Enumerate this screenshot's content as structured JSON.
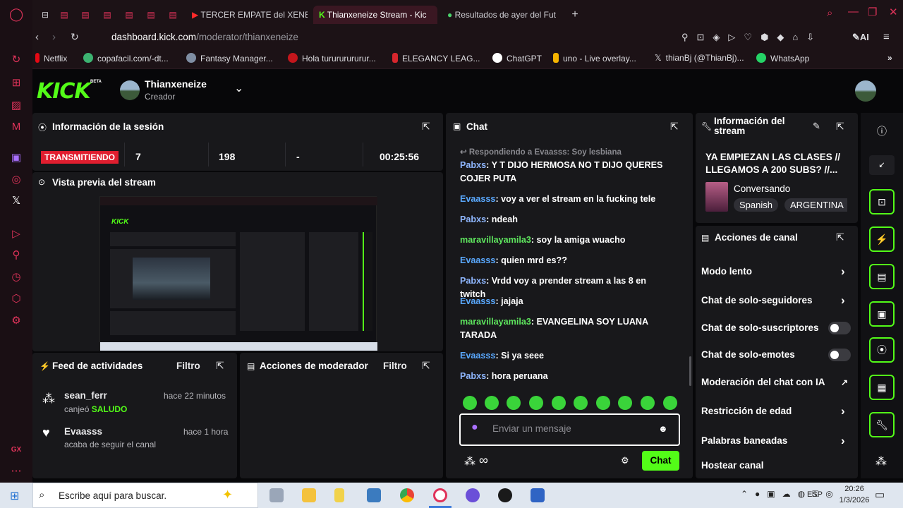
{
  "browser": {
    "tabs": [
      {
        "label": "TERCER EMPATE del XENE",
        "active": false
      },
      {
        "label": "Thianxeneize Stream - Kic",
        "active": true
      },
      {
        "label": "Resultados de ayer del Fut",
        "active": false
      }
    ],
    "new_tab": "+",
    "url_host": "dashboard.kick.com",
    "url_path": "/moderator/thianxeneize",
    "ai_label": "AI",
    "bookmarks": [
      "Netflix",
      "copafacil.com/-dt...",
      "Fantasy Manager...",
      "Hola turururururur...",
      "ELEGANCY LEAG...",
      "ChatGPT",
      "uno - Live overlay...",
      "thianBj (@ThianBj)...",
      "WhatsApp"
    ],
    "gx_label": "GX"
  },
  "header": {
    "logo": "KICK",
    "logo_badge": "BETA",
    "channel_name": "Thianxeneize",
    "channel_role": "Creador"
  },
  "session": {
    "title": "Información de la sesión",
    "status_badge": "TRANSMITIENDO",
    "stats": [
      "7",
      "198",
      "-",
      "00:25:56"
    ]
  },
  "preview": {
    "title": "Vista previa del stream"
  },
  "activity": {
    "title": "Feed de actividades",
    "filter": "Filtro",
    "items": [
      {
        "user": "sean_ferr",
        "time": "hace 22 minutos",
        "text": "canjeó",
        "highlight": "SALUDO"
      },
      {
        "user": "Evaasss",
        "time": "hace 1 hora",
        "text": "acaba de seguir el canal",
        "highlight": ""
      }
    ]
  },
  "mod_actions": {
    "title": "Acciones de moderador",
    "filter": "Filtro"
  },
  "chat": {
    "title": "Chat",
    "reply_context": "Respondiendo a Evaasss: Soy lesbiana",
    "messages": [
      {
        "user": "Pabxs",
        "text": "Y T DIJO HERMOSA NO T DIJO QUERES COJER PUTA",
        "color": "#8fb7ff"
      },
      {
        "user": "Evaasss",
        "text": "voy a ver el stream en la fucking tele",
        "color": "#5aa9ff"
      },
      {
        "user": "Pabxs",
        "text": "ndeah",
        "color": "#8fb7ff"
      },
      {
        "user": "maravillayamila3",
        "text": "soy la amiga wuacho",
        "color": "#5ee65e"
      },
      {
        "user": "Evaasss",
        "text": "quien mrd es??",
        "color": "#5aa9ff"
      },
      {
        "user": "Pabxs",
        "text": "Vrdd voy a prender stream a las 8 en twitch",
        "color": "#8fb7ff"
      },
      {
        "user": "Evaasss",
        "text": "jajaja",
        "color": "#5aa9ff"
      },
      {
        "user": "maravillayamila3",
        "text": "EVANGELINA SOY LUANA TARADA",
        "color": "#5ee65e"
      },
      {
        "user": "Evaasss",
        "text": "Si ya seee",
        "color": "#5aa9ff"
      },
      {
        "user": "Pabxs",
        "text": "hora peruana",
        "color": "#8fb7ff"
      }
    ],
    "input_placeholder": "Enviar un mensaje",
    "infinity": "∞",
    "send_label": "Chat"
  },
  "stream_info": {
    "title": "Información del stream",
    "stream_title": "YA EMPIEZAN LAS CLASES // LLEGAMOS A 200 SUBS? //...",
    "category": "Conversando",
    "tags": [
      "Spanish",
      "ARGENTINA"
    ]
  },
  "channel_actions": {
    "title": "Acciones de canal",
    "items": [
      {
        "label": "Modo lento",
        "control": "chevron"
      },
      {
        "label": "Chat de solo-seguidores",
        "control": "chevron"
      },
      {
        "label": "Chat de solo-suscriptores",
        "control": "toggle"
      },
      {
        "label": "Chat de solo-emotes",
        "control": "toggle"
      },
      {
        "label": "Moderación del chat con IA",
        "control": "external"
      },
      {
        "label": "Restricción de edad",
        "control": "chevron"
      },
      {
        "label": "Palabras baneadas",
        "control": "chevron"
      },
      {
        "label": "Hostear canal",
        "control": "none"
      }
    ]
  },
  "taskbar": {
    "search_placeholder": "Escribe aquí para buscar.",
    "language": "ESP",
    "time": "20:26",
    "date": "1/3/2026"
  }
}
